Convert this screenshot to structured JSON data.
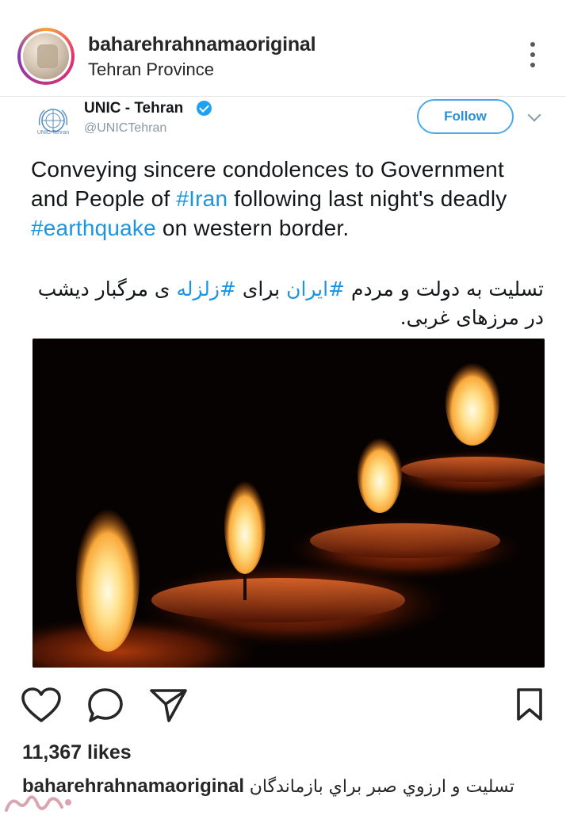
{
  "post": {
    "username": "baharehrahnamaoriginal",
    "location": "Tehran Province"
  },
  "tweet": {
    "org_caption": "UNIC Tehran",
    "name": "UNIC - Tehran",
    "handle": "@UNICTehran",
    "follow_label": "Follow",
    "en_part1": "Conveying sincere condolences to Government and People of ",
    "en_tag1": "#Iran",
    "en_part2": " following last night's deadly ",
    "en_tag2": "#earthquake",
    "en_part3": " on western border.",
    "fa_part1": "تسلیت به دولت و مردم ",
    "fa_tag1": "#ایران",
    "fa_part2": " برای ",
    "fa_tag2": "#زلزله",
    "fa_part3": " ی مرگبار دیشب در مرزهای غربی."
  },
  "icons": {
    "more": "more-vertical-icon",
    "like": "heart-icon",
    "comment": "comment-icon",
    "share": "send-icon",
    "save": "bookmark-icon"
  },
  "stats": {
    "likes": "11,367 likes"
  },
  "caption": {
    "username": "baharehrahnamaoriginal",
    "text": "تسلیت و ارزوي صبر براي بازماندگان"
  },
  "colors": {
    "link_blue": "#1b95e0",
    "follow_blue": "#2b8fd6",
    "text_dark": "#262626"
  }
}
